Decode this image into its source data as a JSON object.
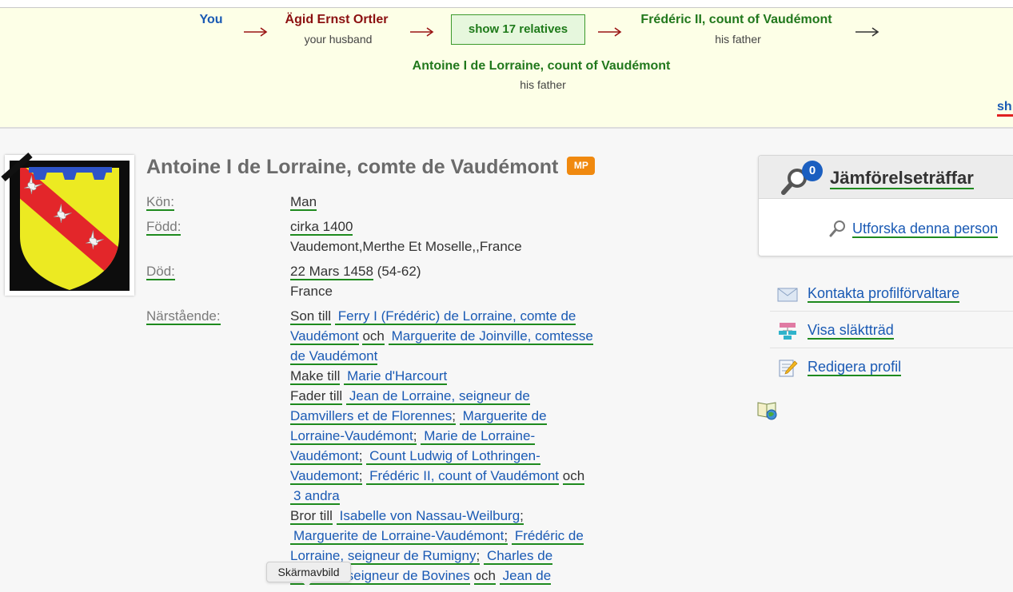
{
  "breadcrumb": {
    "you": "You",
    "step1": {
      "name": "Ägid Ernst Ortler",
      "relation": "your husband"
    },
    "show_relatives": "show 17 relatives",
    "step2": {
      "name": "Frédéric II, count of Vaudémont",
      "relation": "his father"
    },
    "step3": {
      "name": "Antoine I de Lorraine, count of Vaudémont",
      "relation": "his father"
    },
    "show_link_partial": "sh"
  },
  "profile": {
    "name": "Antoine I de Lorraine, comte de Vaudémont",
    "badge": "MP",
    "fields": {
      "gender": {
        "label": "Kön:",
        "value": "Man"
      },
      "born": {
        "label": "Född:",
        "date": "cirka 1400",
        "place": "Vaudemont,Merthe Et Moselle,,France"
      },
      "died": {
        "label": "Död:",
        "date": "22 Mars 1458",
        "age": "(54-62)",
        "place": "France"
      },
      "relatives": {
        "label": "Närstående:",
        "son_of": {
          "prefix": "Son till",
          "links": [
            "Ferry I (Frédéric) de Lorraine, comte de Vaudémont",
            "Marguerite de Joinville, comtesse de Vaudémont"
          ],
          "conjunction": "och"
        },
        "husband_of": {
          "prefix": "Make till",
          "links": [
            "Marie d'Harcourt"
          ]
        },
        "father_of": {
          "prefix": "Fader till",
          "links": [
            "Jean de Lorraine, seigneur de Damvillers et de Florennes",
            "Marguerite de Lorraine-Vaudémont",
            "Marie de Lorraine-Vaudémont",
            "Count Ludwig of Lothringen-Vaudemont",
            "Frédéric II, count of Vaudémont"
          ],
          "separator": ";",
          "conjunction": "och",
          "more": "3 andra"
        },
        "brother_of": {
          "prefix": "Bror till",
          "links": [
            "Isabelle von Nassau-Weilburg",
            "Marguerite de Lorraine-Vaudémont",
            "Frédéric de Lorraine, seigneur de Rumigny",
            {
              "start": "Charles de",
              "end": "seigneur de Bovines"
            },
            "Jean de"
          ],
          "separator": ";",
          "conjunction": "och"
        }
      }
    }
  },
  "sidebar": {
    "matches": {
      "title": "Jämförelseträffar",
      "count": "0",
      "explore_link": "Utforska denna person"
    },
    "actions": [
      {
        "label": "Kontakta profilförvaltare",
        "icon": "envelope-icon"
      },
      {
        "label": "Visa släktträd",
        "icon": "family-tree-icon"
      },
      {
        "label": "Redigera profil",
        "icon": "edit-profile-icon"
      }
    ],
    "extra_icon": "book-globe-icon"
  },
  "tooltip": {
    "text": "Skärmavbild"
  },
  "colors": {
    "link_blue": "#1a5ab4",
    "path_green": "#21781c",
    "husband_red": "#8b1010",
    "underline_green": "#1e8a1e",
    "badge_orange": "#f0890f",
    "band_yellow": "#fdffe7"
  }
}
